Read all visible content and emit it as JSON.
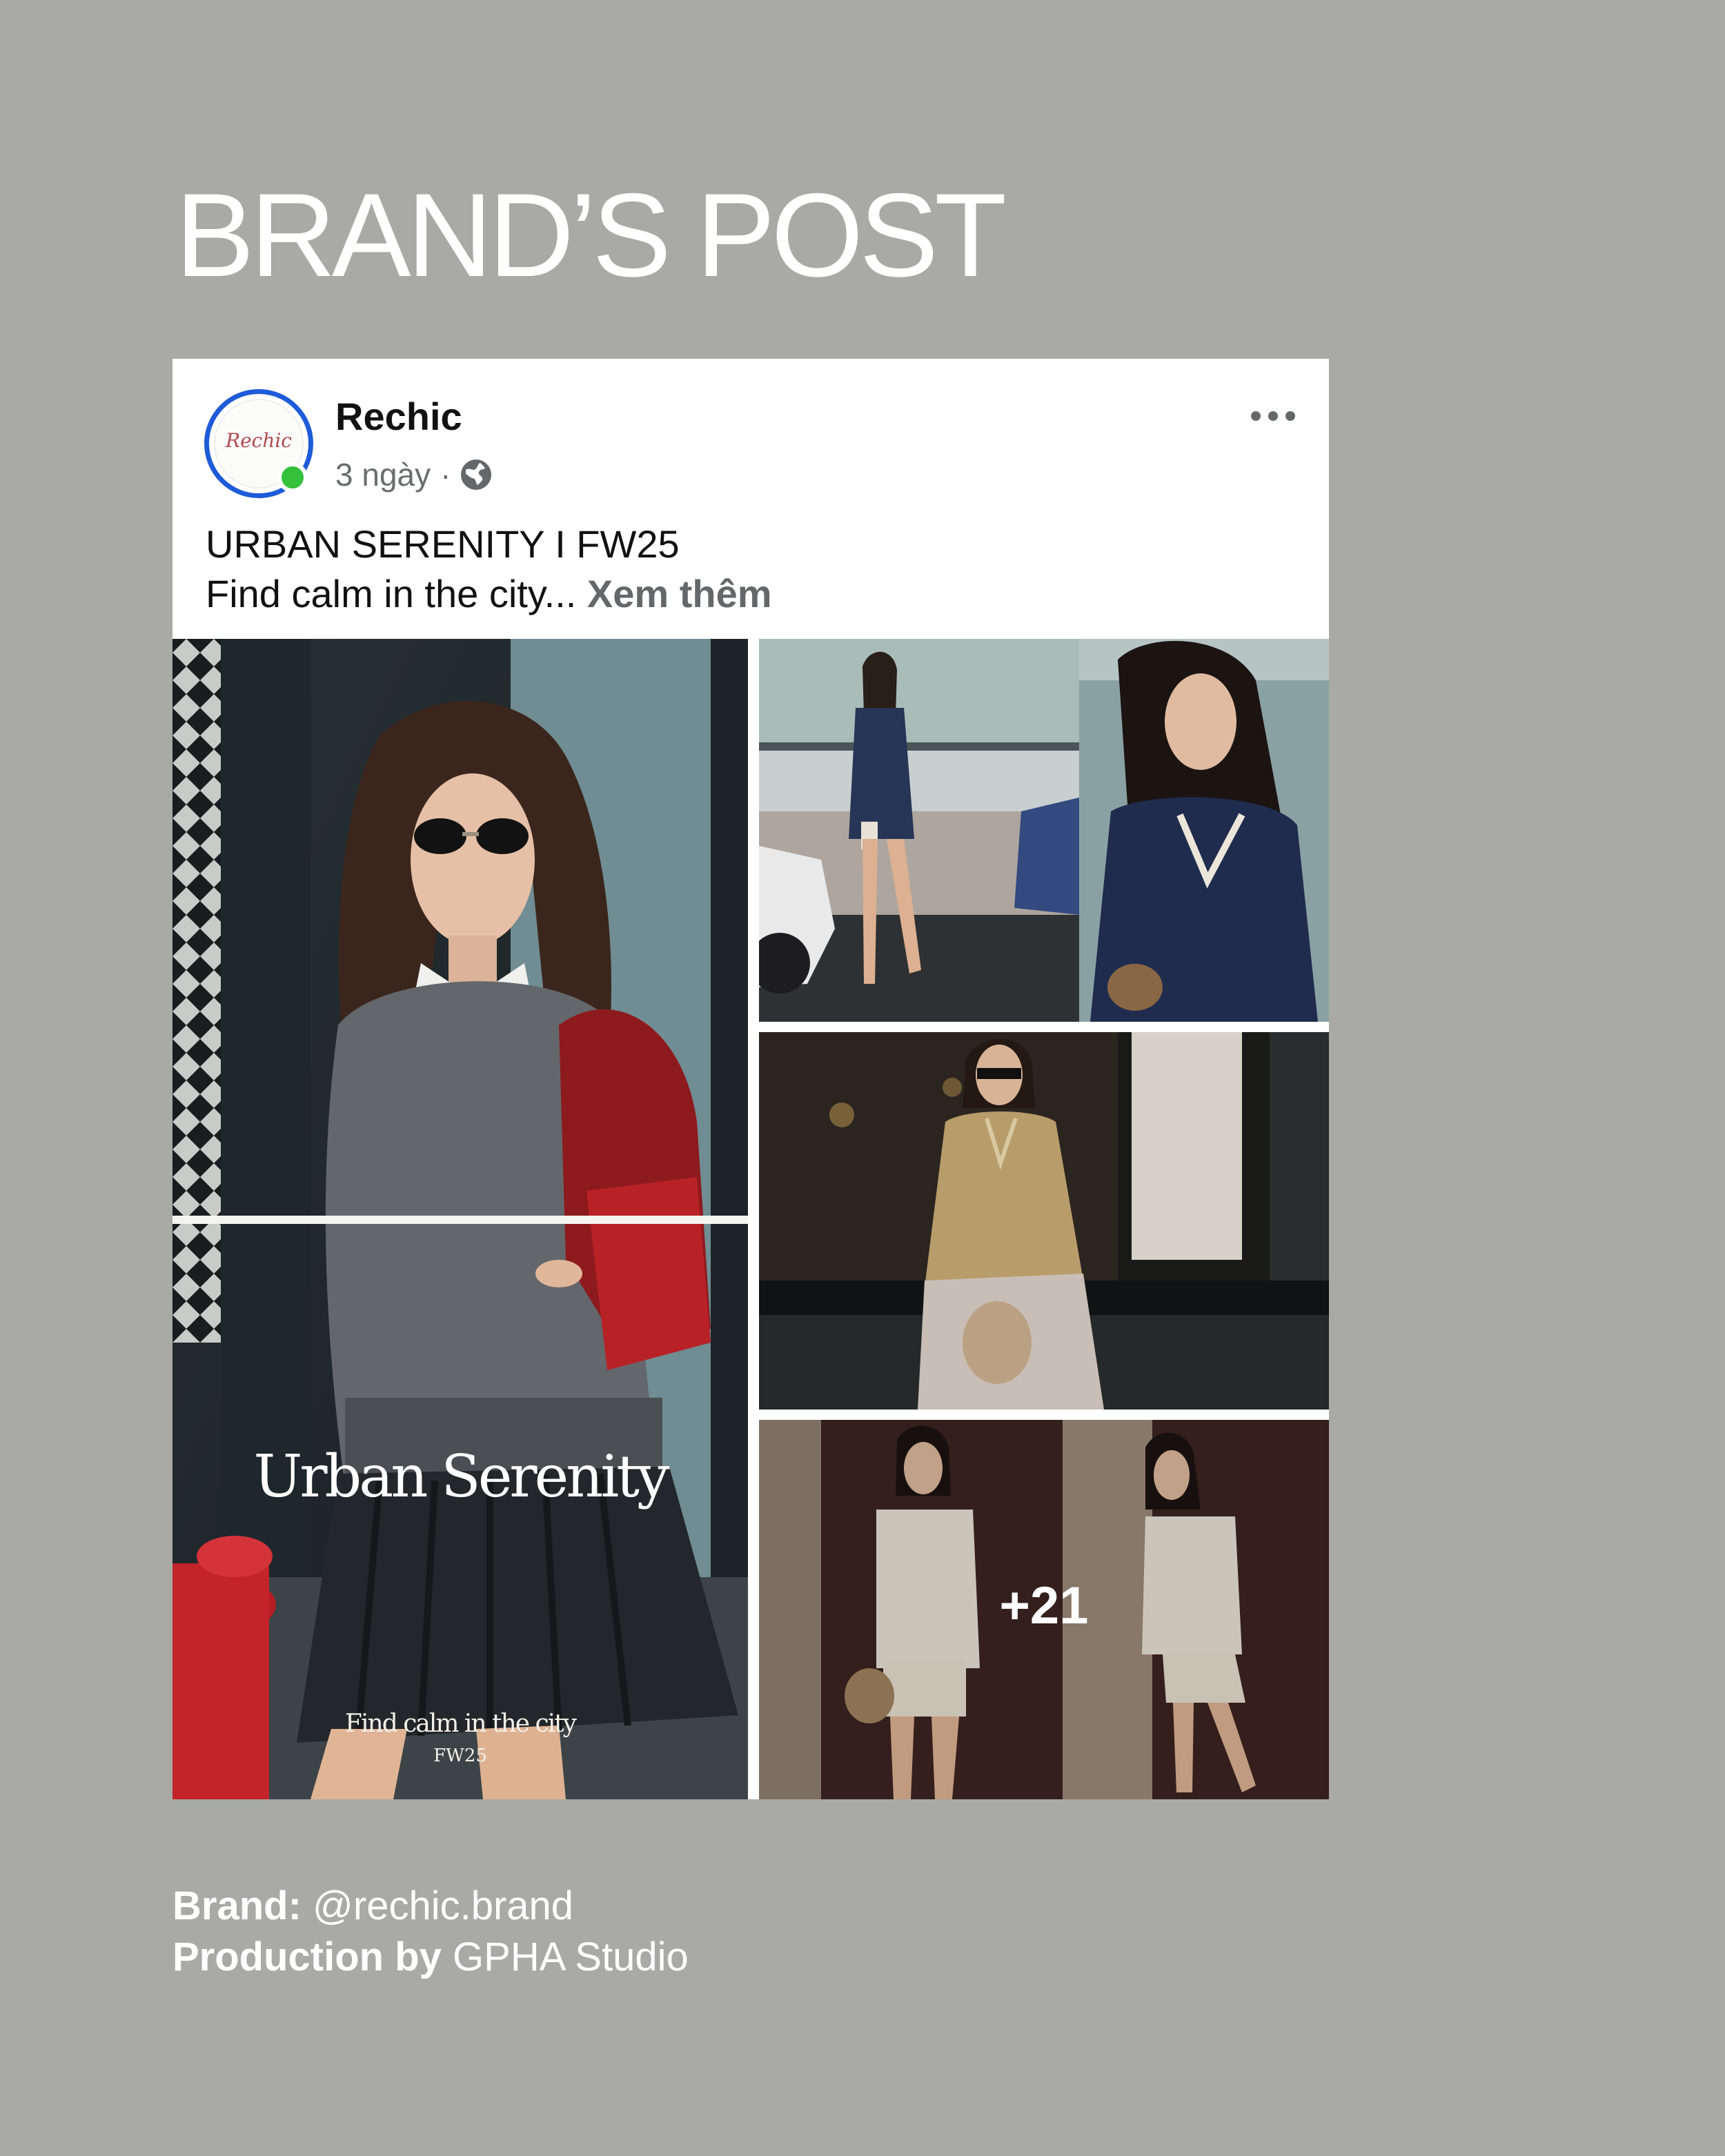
{
  "page": {
    "heading": "BRAND’S POST"
  },
  "post": {
    "page_name": "Rechic",
    "avatar_logo_text": "Rechic",
    "time": "3 ngày",
    "separator": "·",
    "privacy_icon": "globe-icon",
    "menu_icon": "more-options-icon",
    "caption_line_1": "URBAN SERENITY I FW25",
    "caption_line_2": "Find calm in the city...",
    "see_more": "Xem thêm",
    "photos": {
      "main_overlay_title": "Urban Serenity",
      "main_overlay_subtitle": "Find calm in the city",
      "main_overlay_season": "FW25",
      "more_count": "+21"
    }
  },
  "credits": {
    "brand_label": "Brand:",
    "brand_value": "@rechic.brand",
    "production_label": "Production by",
    "production_value": "GPHA Studio"
  },
  "colors": {
    "background": "#a9aaa5",
    "card": "#ffffff",
    "avatar_ring": "#1d5bd8",
    "online": "#34c13b",
    "secondary_text": "#65676b"
  }
}
